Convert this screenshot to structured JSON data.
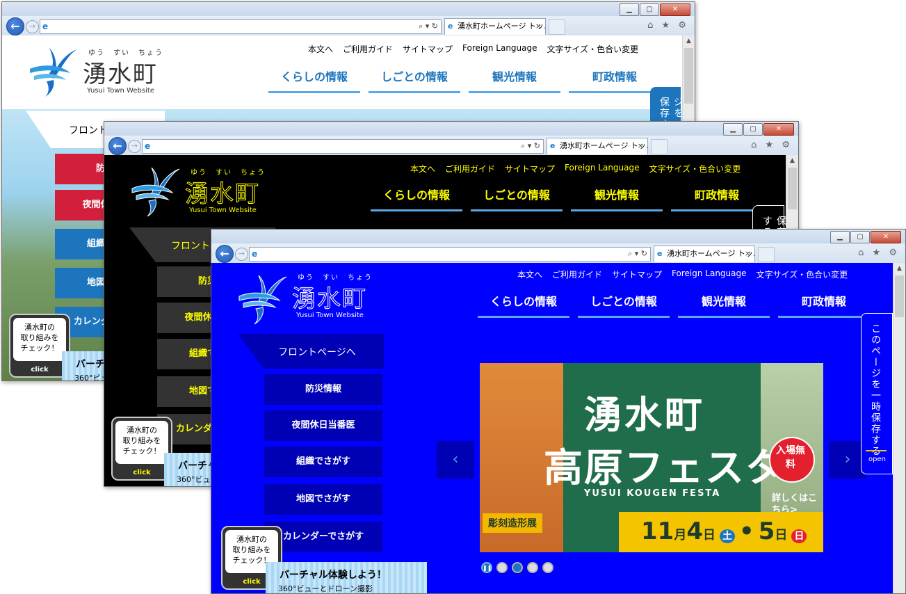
{
  "browser": {
    "tab_title": "湧水町ホームページ トッ...",
    "tab_close": "×",
    "address_tools": "⌕ ▾ ↻",
    "right_tools": "⌂ ★ ⚙"
  },
  "site": {
    "logo_ruby": "ゆう　すい　ちょう",
    "logo_name": "湧水町",
    "logo_sub": "Yusui Town Website",
    "util_links": [
      "本文へ",
      "ご利用ガイド",
      "サイトマップ",
      "Foreign Language",
      "文字サイズ・色合い変更"
    ],
    "nav": [
      "くらしの情報",
      "しごとの情報",
      "観光情報",
      "町政情報"
    ],
    "front_link": "フロントページへ",
    "menu": [
      "防災情報",
      "夜間休日当番医",
      "組織でさがす",
      "地図でさがす",
      "カレンダーでさがす"
    ],
    "check_badge": {
      "line1": "湧水町の",
      "line2": "取り組みを",
      "line3": "チェック！",
      "click": "click"
    },
    "virtual_title": "バーチャル体験しよう！",
    "virtual_sub": "360°ビューとドローン撮影",
    "save_tab": "このページを一時保存する",
    "save_open": "open"
  },
  "banner": {
    "title_line1": "湧水町",
    "title_line2": "高原フェスタ",
    "subtitle": "YUSUI KOUGEN FESTA",
    "badge": "入場無料",
    "details": "詳しくはこちら>",
    "tag": "彫刻造形展",
    "date_month": "11",
    "date_day1": "4",
    "date_dow1": "土",
    "date_day2": "5",
    "date_dow2": "日",
    "month_unit": "月",
    "day_unit": "日",
    "dot_sep": "•"
  },
  "colors": {
    "theme_white_bg": "#ffffff",
    "theme_black_bg": "#000000",
    "theme_blue_bg": "#0000ff",
    "nav_underline": "#5aa9e6",
    "red_menu": "#d21f3c",
    "blue_menu": "#1c75bd",
    "yellow_text": "#ffff00"
  }
}
